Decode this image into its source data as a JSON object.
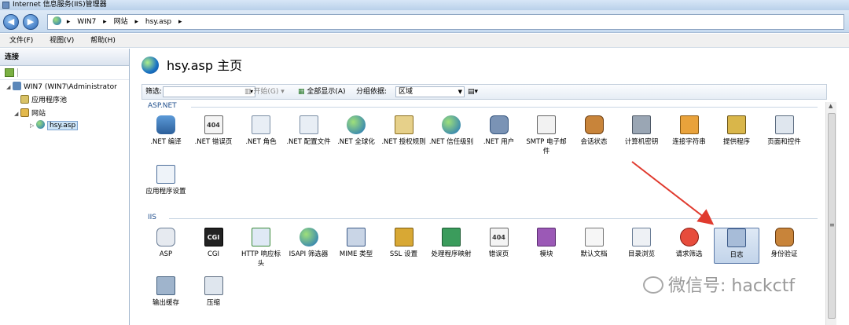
{
  "window": {
    "title": "Internet 信息服务(IIS)管理器"
  },
  "address": {
    "crumbs": [
      "WIN7",
      "网站",
      "hsy.asp"
    ],
    "sep": "▸"
  },
  "menu": [
    "文件(F)",
    "视图(V)",
    "帮助(H)"
  ],
  "left": {
    "header": "连接",
    "tree": [
      {
        "label": "WIN7 (WIN7\\Administrator",
        "arrow": "◢"
      },
      {
        "label": "应用程序池",
        "arrow": ""
      },
      {
        "label": "网站",
        "arrow": "◢"
      },
      {
        "label": "hsy.asp",
        "arrow": "▷"
      }
    ]
  },
  "main": {
    "title": "hsy.asp 主页",
    "filter": {
      "label": "筛选:",
      "start": "开始(G)",
      "showall": "全部显示(A)",
      "groupby": "分组依据:",
      "groupval": "区域"
    },
    "groups": [
      {
        "name": "ASP.NET",
        "items": [
          ".NET 编译",
          ".NET 错误页",
          ".NET 角色",
          ".NET 配置文件",
          ".NET 全球化",
          ".NET 授权规则",
          ".NET 信任级别",
          ".NET 用户",
          "SMTP 电子邮件",
          "会话状态",
          "计算机密钥",
          "连接字符串",
          "提供程序",
          "页面和控件",
          "应用程序设置"
        ]
      },
      {
        "name": "IIS",
        "items": [
          "ASP",
          "CGI",
          "HTTP 响应标头",
          "ISAPI 筛选器",
          "MIME 类型",
          "SSL 设置",
          "处理程序映射",
          "错误页",
          "模块",
          "默认文档",
          "目录浏览",
          "请求筛选",
          "日志",
          "身份验证",
          "输出缓存",
          "压缩"
        ]
      }
    ],
    "icon_texts": {
      "cgi": "CGI",
      "err404": "404"
    }
  },
  "watermark": "微信号: hackctf",
  "colors": {
    "accent": "#1f4e8c",
    "arrow": "#e03a2e",
    "selection": "#c2d4ea"
  }
}
